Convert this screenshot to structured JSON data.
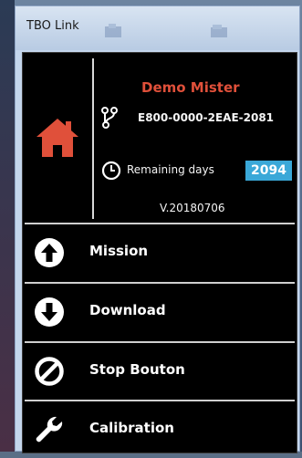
{
  "window": {
    "title": "TBO Link"
  },
  "header": {
    "user_name": "Demo Mister",
    "device_id": "E800-0000-2EAE-2081",
    "remaining_label": "Remaining days",
    "remaining_days": "2094",
    "version": "V.20180706"
  },
  "menu": {
    "items": [
      {
        "label": "Mission",
        "icon": "arrow-up-circle-icon"
      },
      {
        "label": "Download",
        "icon": "arrow-down-circle-icon"
      },
      {
        "label": "Stop Bouton",
        "icon": "stop-circle-icon"
      },
      {
        "label": "Calibration",
        "icon": "wrench-icon"
      }
    ]
  },
  "colors": {
    "panel_bg": "#000000",
    "accent_red": "#e0503a",
    "badge_blue": "#3aa8d8",
    "text": "#f4f4f4"
  }
}
